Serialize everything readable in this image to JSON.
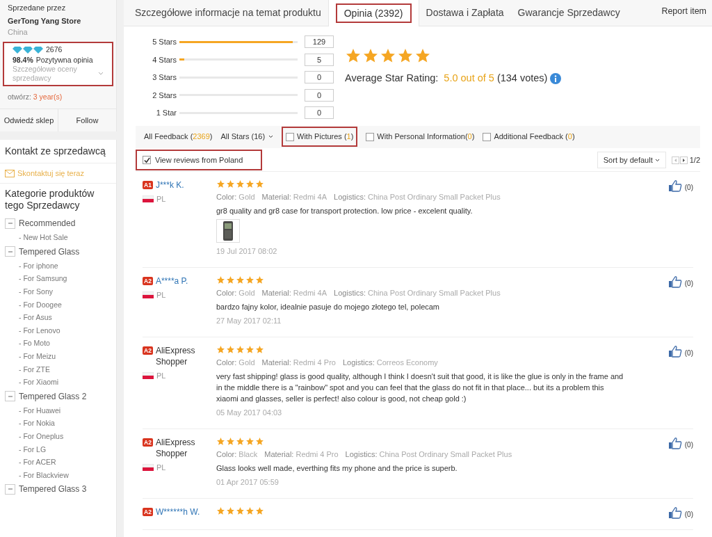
{
  "seller": {
    "caption": "Sprzedane przez",
    "store": "GerTong Yang Store",
    "country": "China",
    "score": "2676",
    "positive_pct": "98.4%",
    "positive_label": "Pozytywna opinia",
    "details": "Szczegółowe oceny sprzedawcy",
    "open_label": "otwórz:",
    "open_value": "3 year(s)",
    "buttons": [
      "Odwiedź sklep",
      "Follow"
    ]
  },
  "contact": {
    "title": "Kontakt ze sprzedawcą",
    "link": "Skontaktuj się teraz"
  },
  "categories": {
    "title": "Kategorie produktów tego Sprzedawcy",
    "groups": [
      {
        "label": "Recommended",
        "expanded": true,
        "children": [
          {
            "label": "- New Hot Sale"
          }
        ]
      },
      {
        "label": "Tempered Glass",
        "expanded": true,
        "children": [
          {
            "label": "- For iphone"
          },
          {
            "label": "- For Samsung"
          },
          {
            "label": "- For Sony"
          },
          {
            "label": "- For Doogee"
          },
          {
            "label": "- For Asus"
          },
          {
            "label": "- For Lenovo"
          },
          {
            "label": "- Fo Moto"
          },
          {
            "label": "- For Meizu"
          },
          {
            "label": "- For ZTE"
          },
          {
            "label": "- For Xiaomi"
          }
        ]
      },
      {
        "label": "Tempered Glass 2",
        "expanded": true,
        "children": [
          {
            "label": "- For Huawei"
          },
          {
            "label": "- For Nokia"
          },
          {
            "label": "- For Oneplus"
          },
          {
            "label": "- For LG"
          },
          {
            "label": "- For ACER"
          },
          {
            "label": "- For Blackview"
          }
        ]
      },
      {
        "label": "Tempered Glass 3",
        "expanded": true
      }
    ]
  },
  "tabs": [
    {
      "label": "Szczegółowe informacje na temat produktu",
      "selected": false
    },
    {
      "label": "Opinia (2392)",
      "selected": true
    },
    {
      "label": "Dostawa i Zapłata",
      "selected": false
    },
    {
      "label": "Gwarancje Sprzedawcy",
      "selected": false
    }
  ],
  "report_link": "Report item",
  "histogram": [
    {
      "label": "5 Stars",
      "level": 0.96,
      "count": "129"
    },
    {
      "label": "4 Stars",
      "level": 0.04,
      "count": "5"
    },
    {
      "label": "3 Stars",
      "count": "0"
    },
    {
      "label": "2 Stars",
      "count": "0"
    },
    {
      "label": "1 Star",
      "count": "0"
    }
  ],
  "average": {
    "stars": 5,
    "label": "Average Star Rating:",
    "value": "5.0 out of 5",
    "votes": "(134 votes)"
  },
  "filters": [
    {
      "kind": "link",
      "prefix": "All Feedback (",
      "count": "2369",
      "suffix": ")"
    },
    {
      "kind": "dropdown",
      "prefix": "All Stars (16)"
    },
    {
      "kind": "checkbox",
      "checked": false,
      "prefix": "With Pictures (",
      "count": "1",
      "suffix": ")"
    },
    {
      "kind": "checkbox",
      "checked": false,
      "prefix": "With Personal Information(",
      "count": "0",
      "suffix": ")"
    },
    {
      "kind": "checkbox",
      "checked": false,
      "prefix": "Additional Feedback (",
      "count": "0",
      "suffix": ")"
    }
  ],
  "poland_filter": {
    "label": "View reviews from Poland",
    "checked": true
  },
  "sort": "Sort by default",
  "pages": "1/2",
  "reviews": [
    {
      "badge": "A1",
      "name": "J***k K.",
      "kind": "masked",
      "country": "PL",
      "stars": 5,
      "attrs": [
        {
          "key": "Color:",
          "value": "Gold"
        },
        {
          "key": "Material:",
          "value": "Redmi 4A"
        },
        {
          "key": "Logistics:",
          "value": "China Post Ordinary Small Packet Plus"
        }
      ],
      "text": "gr8 quality and gr8 case for transport protection. low price - excelent quality.",
      "photos": [
        {
          "kind": "picture"
        }
      ],
      "date": "19 Jul 2017 08:02",
      "likes": "(0)"
    },
    {
      "badge": "A2",
      "name": "A****a P.",
      "kind": "masked",
      "country": "PL",
      "stars": 5,
      "attrs": [
        {
          "key": "Color:",
          "value": "Gold"
        },
        {
          "key": "Material:",
          "value": "Redmi 4A"
        },
        {
          "key": "Logistics:",
          "value": "China Post Ordinary Small Packet Plus"
        }
      ],
      "text": "bardzo fajny kolor, idealnie pasuje do mojego złotego tel, polecam",
      "date": "27 May 2017 02:11",
      "likes": "(0)"
    },
    {
      "badge": "A2",
      "name": "AliExpress Shopper",
      "kind": "generic",
      "country": "PL",
      "stars": 5,
      "attrs": [
        {
          "key": "Color:",
          "value": "Gold"
        },
        {
          "key": "Material:",
          "value": "Redmi 4 Pro"
        },
        {
          "key": "Logistics:",
          "value": "Correos Economy"
        }
      ],
      "text": "very fast shipping! glass is good quality, although I think I doesn't suit that good, it is like the glue is only in the frame and in the middle there is a \"rainbow\" spot and you can feel that the glass do not fit in that place... but its a problem this xiaomi and glasses, seller is perfect! also colour is good, not cheap gold :)",
      "date": "05 May 2017 04:03",
      "likes": "(0)"
    },
    {
      "badge": "A2",
      "name": "AliExpress Shopper",
      "kind": "generic",
      "country": "PL",
      "stars": 5,
      "attrs": [
        {
          "key": "Color:",
          "value": "Black"
        },
        {
          "key": "Material:",
          "value": "Redmi 4 Pro"
        },
        {
          "key": "Logistics:",
          "value": "China Post Ordinary Small Packet Plus"
        }
      ],
      "text": "Glass looks well made, everthing fits my phone and the price is superb.",
      "date": "01 Apr 2017 05:59",
      "likes": "(0)"
    },
    {
      "badge": "A2",
      "name": "W******h W.",
      "kind": "masked",
      "stars": 5,
      "likes": "(0)"
    }
  ]
}
